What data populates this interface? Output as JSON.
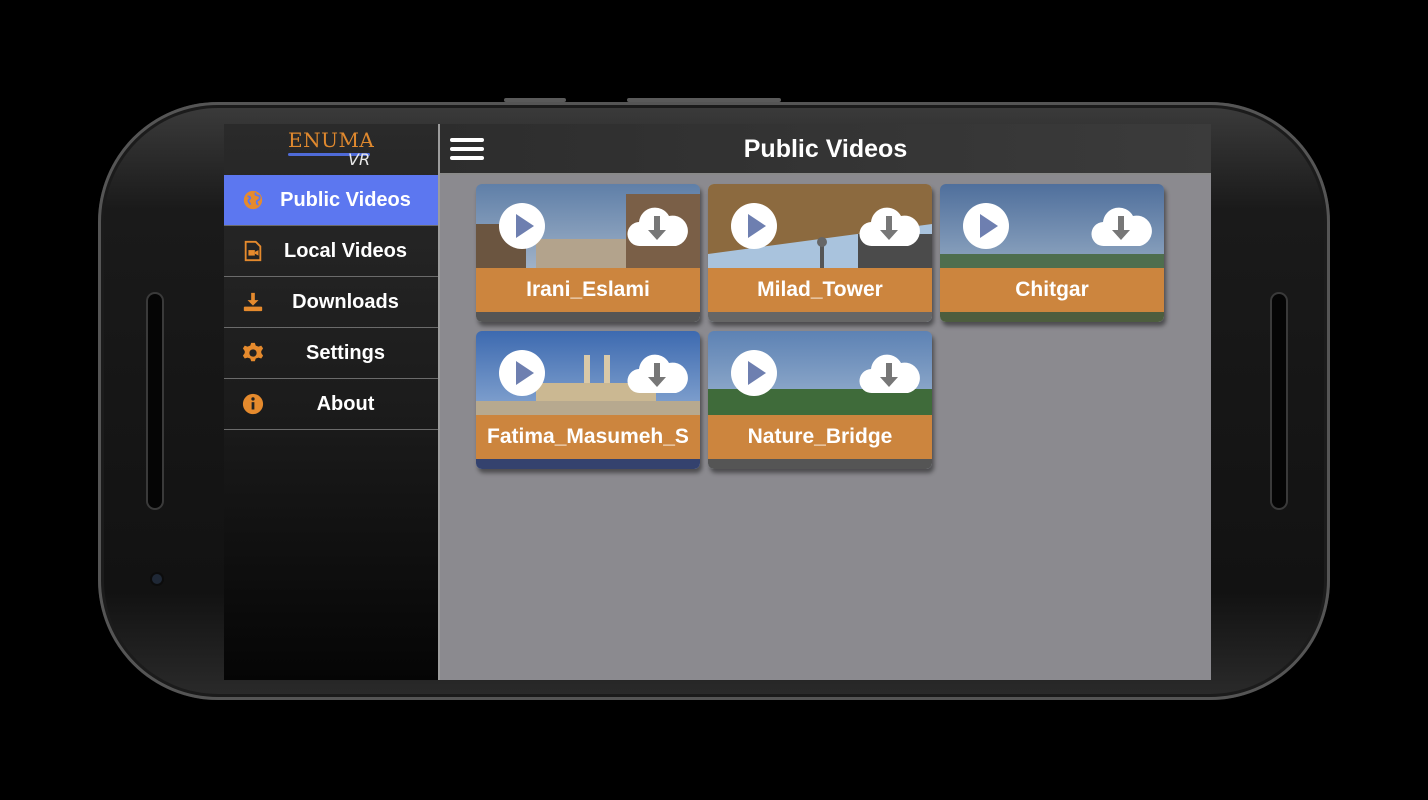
{
  "app": {
    "logo_text": "ENUMA",
    "logo_sub": "VR"
  },
  "sidebar": {
    "items": [
      {
        "label": "Public Videos",
        "icon": "globe-icon",
        "active": true
      },
      {
        "label": "Local Videos",
        "icon": "video-file-icon",
        "active": false
      },
      {
        "label": "Downloads",
        "icon": "download-tray-icon",
        "active": false
      },
      {
        "label": "Settings",
        "icon": "gear-icon",
        "active": false
      },
      {
        "label": "About",
        "icon": "info-icon",
        "active": false
      }
    ]
  },
  "header": {
    "title": "Public Videos",
    "menu_icon": "hamburger-icon"
  },
  "videos": [
    {
      "title": "Irani_Eslami"
    },
    {
      "title": "Milad_Tower"
    },
    {
      "title": "Chitgar"
    },
    {
      "title": "Fatima_Masumeh_S"
    },
    {
      "title": "Nature_Bridge"
    }
  ],
  "colors": {
    "accent_active": "#5c77f0",
    "card_label": "#cc853e",
    "icon_orange": "#e58a2d",
    "content_bg": "#8b8a8f"
  }
}
